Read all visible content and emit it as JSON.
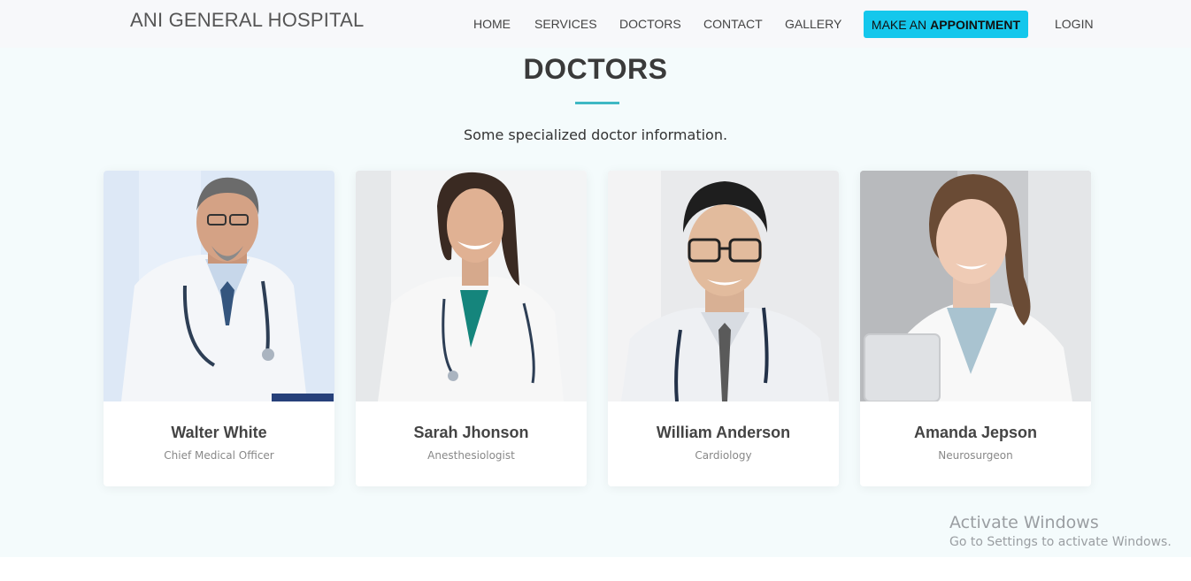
{
  "header": {
    "brand": "ANI GENERAL HOSPITAL",
    "nav": {
      "home": "HOME",
      "services": "SERVICES",
      "doctors": "DOCTORS",
      "contact": "CONTACT",
      "gallery": "GALLERY",
      "login": "LOGIN"
    },
    "appointment": {
      "prefix": "MAKE AN",
      "bold": "APPOINTMENT"
    },
    "accent_color": "#14c7ec"
  },
  "section": {
    "title": "DOCTORS",
    "subtitle": "Some specialized doctor information.",
    "underline_color": "#3fb8c4"
  },
  "doctors": [
    {
      "name": "Walter White",
      "role": "Chief Medical Officer"
    },
    {
      "name": "Sarah Jhonson",
      "role": "Anesthesiologist"
    },
    {
      "name": "William Anderson",
      "role": "Cardiology"
    },
    {
      "name": "Amanda Jepson",
      "role": "Neurosurgeon"
    }
  ],
  "watermark": {
    "line1": "Activate Windows",
    "line2": "Go to Settings to activate Windows."
  }
}
